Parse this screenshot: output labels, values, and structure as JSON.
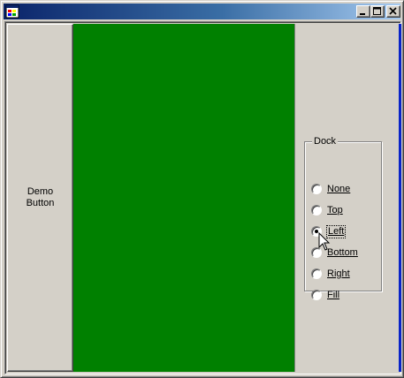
{
  "window": {
    "title": "",
    "controls": {
      "minimize_icon": "minimize-icon",
      "maximize_icon": "maximize-icon",
      "close_icon": "close-icon"
    }
  },
  "demo_button": {
    "label_line1": "Demo",
    "label_line2": "Button"
  },
  "colors": {
    "title_active": "#0a246a",
    "panel_green": "#008000",
    "face": "#d4d0c8"
  },
  "dock_group": {
    "label": "Dock",
    "options": [
      {
        "label": "None",
        "checked": false
      },
      {
        "label": "Top",
        "checked": false
      },
      {
        "label": "Left",
        "checked": true
      },
      {
        "label": "Bottom",
        "checked": false
      },
      {
        "label": "Right",
        "checked": false
      },
      {
        "label": "Fill",
        "checked": false
      }
    ],
    "selected": "Left"
  }
}
